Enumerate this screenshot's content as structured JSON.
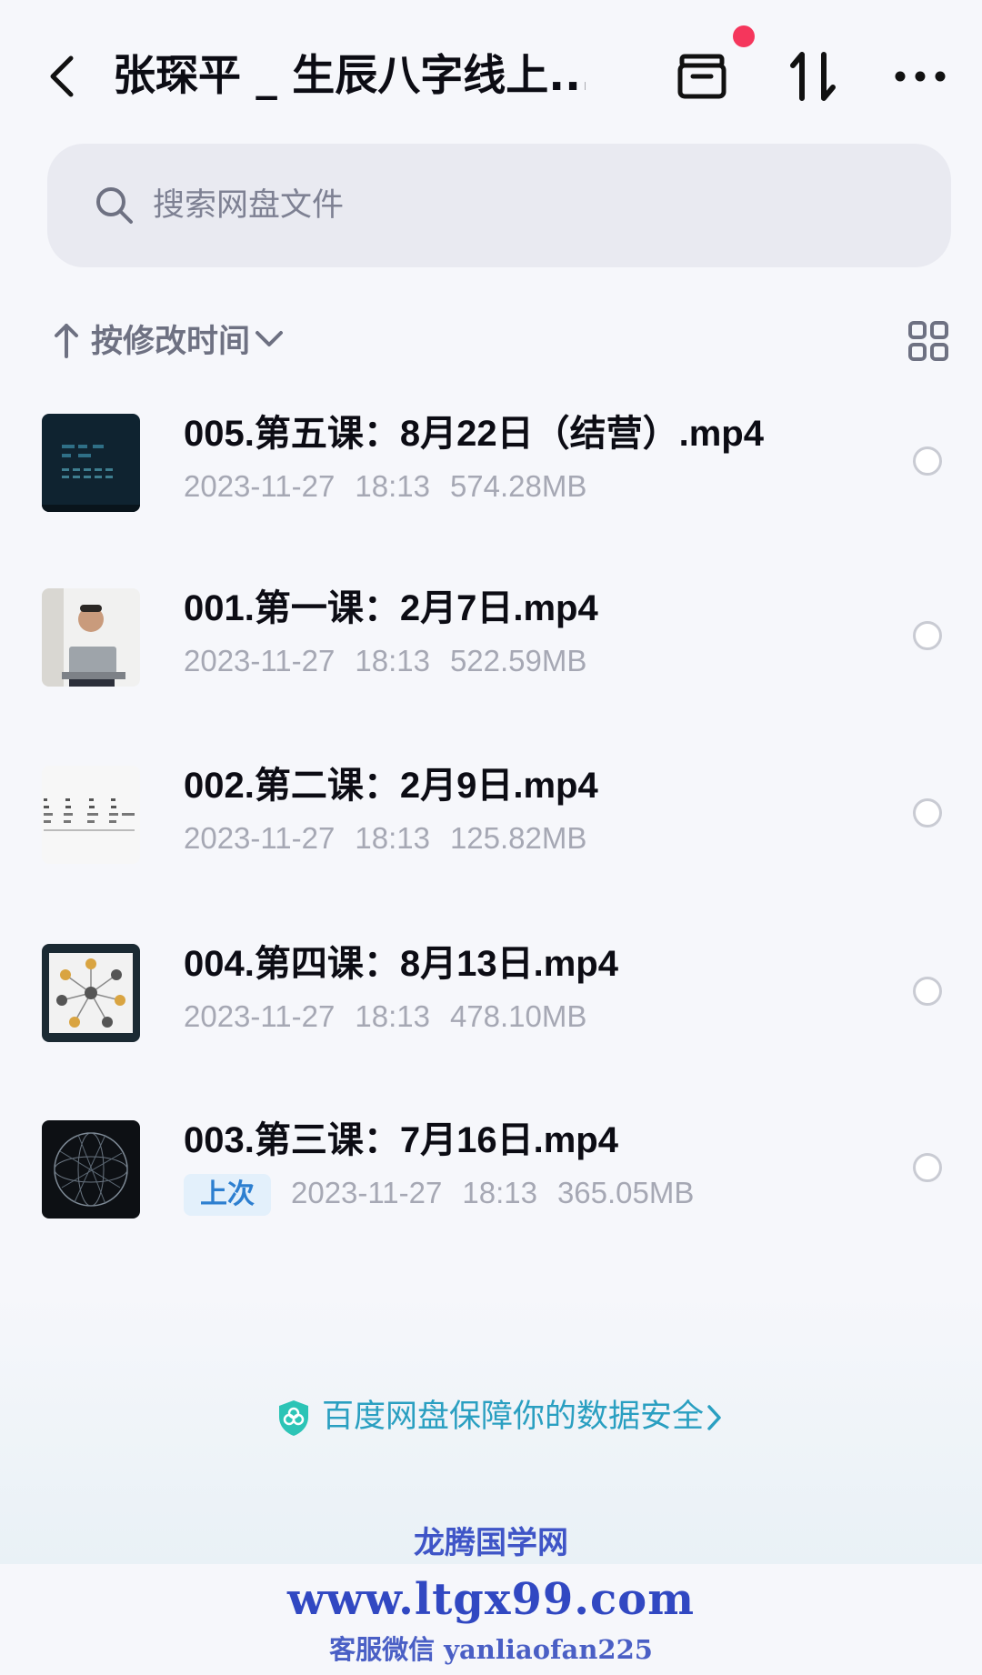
{
  "header": {
    "title": "张琛平 _ 生辰八字线上...",
    "icons": [
      "back-icon",
      "file-tray-icon",
      "transfer-icon",
      "more-icon"
    ]
  },
  "search": {
    "placeholder": "搜索网盘文件"
  },
  "sort": {
    "label": "按修改时间"
  },
  "files": [
    {
      "name": "005.第五课：8月22日（结营）.mp4",
      "date": "2023-11-27",
      "time": "18:13",
      "size": "574.28MB"
    },
    {
      "name": "001.第一课：2月7日.mp4",
      "date": "2023-11-27",
      "time": "18:13",
      "size": "522.59MB"
    },
    {
      "name": "002.第二课：2月9日.mp4",
      "date": "2023-11-27",
      "time": "18:13",
      "size": "125.82MB"
    },
    {
      "name": "004.第四课：8月13日.mp4",
      "date": "2023-11-27",
      "time": "18:13",
      "size": "478.10MB"
    },
    {
      "name": "003.第三课：7月16日.mp4",
      "badge": "上次",
      "date": "2023-11-27",
      "time": "18:13",
      "size": "365.05MB"
    }
  ],
  "security": {
    "text": "百度网盘保障你的数据安全"
  },
  "watermark": {
    "line1": "龙腾国学网",
    "line2": "www.ltgx99.com",
    "line3": "客服微信 yanliaofan225"
  },
  "colors": {
    "accent": "#2a9fc1",
    "notification_dot": "#f5365c",
    "watermark": "#3148c2"
  }
}
